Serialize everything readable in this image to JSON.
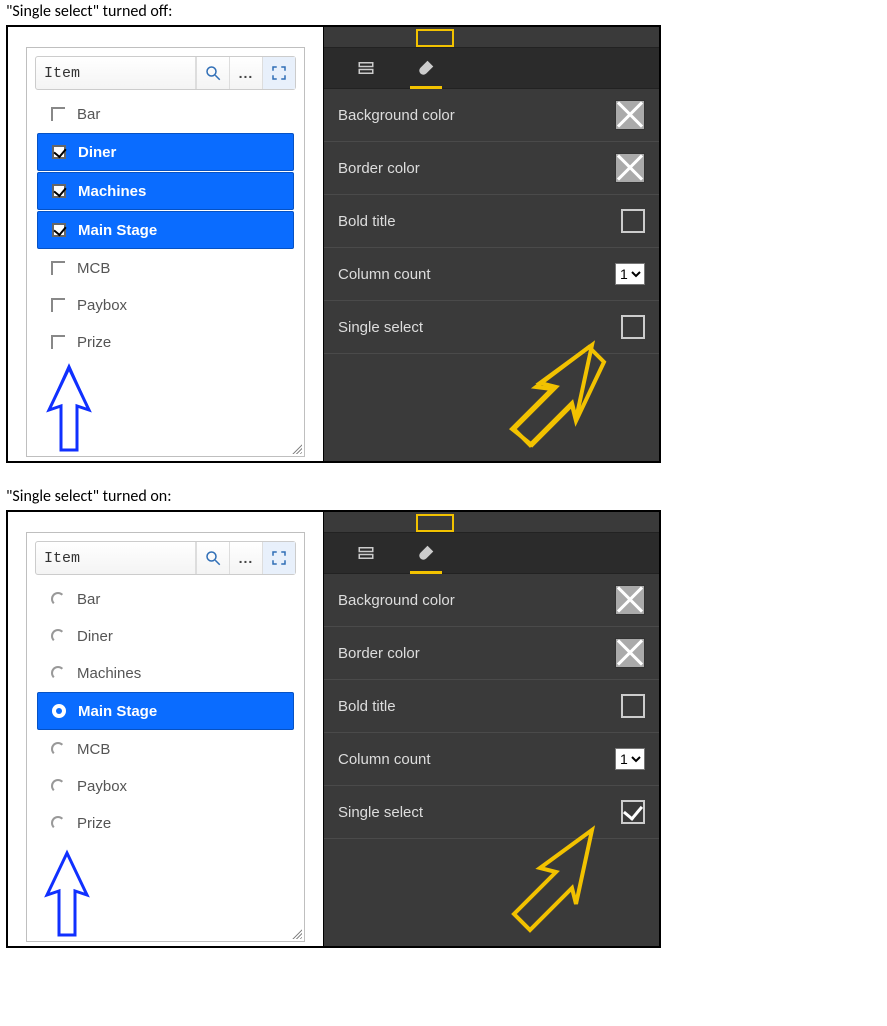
{
  "captions": {
    "off": "\"Single select\" turned off:",
    "on": "\"Single select\" turned on:"
  },
  "filter": {
    "field": "Item",
    "items": [
      "Bar",
      "Diner",
      "Machines",
      "Main Stage",
      "MCB",
      "Paybox",
      "Prize"
    ]
  },
  "selection_off": [
    "Diner",
    "Machines",
    "Main Stage"
  ],
  "selection_on": [
    "Main Stage"
  ],
  "props": {
    "rows": {
      "bg": "Background color",
      "border": "Border color",
      "bold": "Bold title",
      "cols": "Column count",
      "single": "Single select"
    },
    "column_count_value": "1"
  },
  "icons": {
    "search": "search-icon",
    "more": "more-icon",
    "fit": "fit-icon",
    "rows": "rows-icon",
    "brush": "brush-icon"
  }
}
